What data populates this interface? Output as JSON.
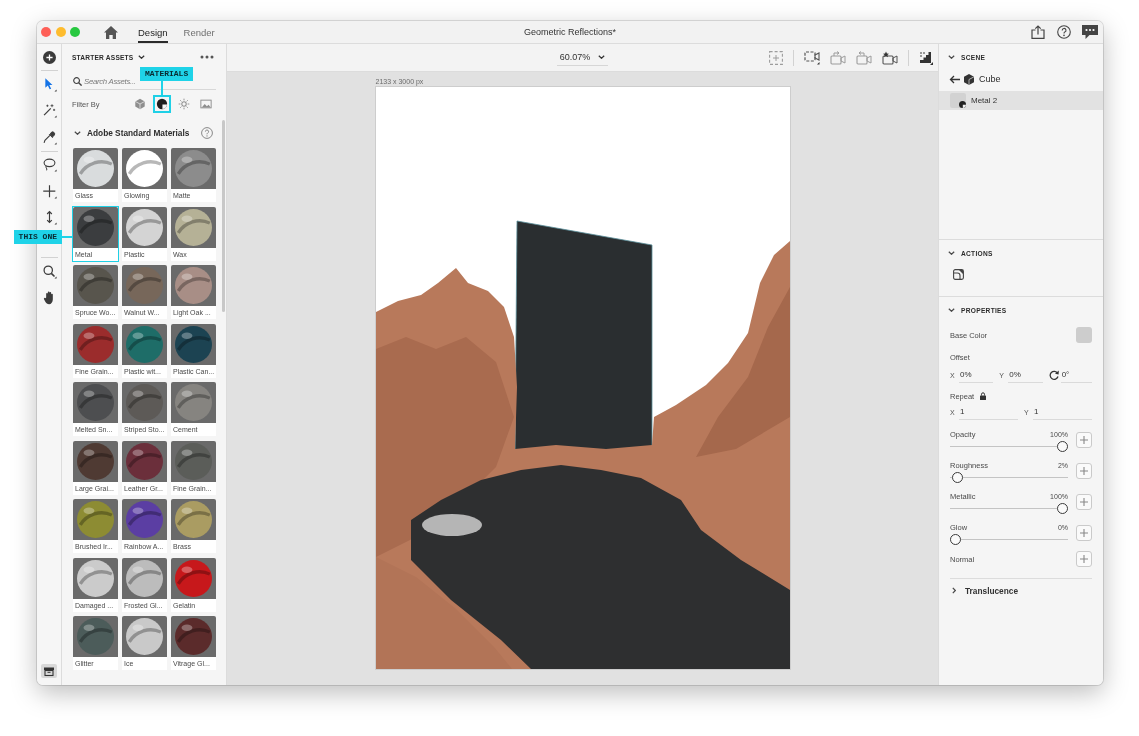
{
  "window": {
    "title": "Geometric Reflections*",
    "tabs": [
      {
        "label": "Design",
        "selected": true
      },
      {
        "label": "Render",
        "selected": false
      }
    ]
  },
  "tool_groups": [
    {
      "tools": [
        {
          "kind": "add",
          "selected": false
        }
      ]
    },
    {
      "tools": [
        {
          "kind": "select",
          "selected": true
        },
        {
          "kind": "wand",
          "selected": false
        },
        {
          "kind": "eyedropper",
          "selected": false
        }
      ]
    },
    {
      "tools": [
        {
          "kind": "lasso",
          "selected": false
        },
        {
          "kind": "move",
          "selected": false
        },
        {
          "kind": "vertical",
          "selected": false
        }
      ]
    },
    {
      "tools": [
        {
          "kind": "zoom",
          "selected": false
        },
        {
          "kind": "hand",
          "selected": false
        }
      ]
    }
  ],
  "assets_panel": {
    "title": "STARTER ASSETS",
    "search": {
      "placeholder": "Search Assets..."
    },
    "filter_label": "Filter By",
    "filters": [
      {
        "kind": "models",
        "selected": false
      },
      {
        "kind": "materials",
        "selected": true,
        "callout": "MATERIALS"
      },
      {
        "kind": "lights",
        "selected": false
      },
      {
        "kind": "images",
        "selected": false
      }
    ],
    "section": {
      "title": "Adobe Standard Materials",
      "expanded": true
    },
    "materials": [
      {
        "label": "Glass",
        "color": "#d9dcdd",
        "selected": false
      },
      {
        "label": "Glowing",
        "color": "#ffffff",
        "selected": false
      },
      {
        "label": "Matte",
        "color": "#8c8c8c",
        "selected": false
      },
      {
        "label": "Metal",
        "color": "#3b3d3f",
        "selected": true,
        "callout": "THIS ONE"
      },
      {
        "label": "Plastic",
        "color": "#d4d4d4",
        "selected": false
      },
      {
        "label": "Wax",
        "color": "#b5b196",
        "selected": false
      },
      {
        "label": "Spruce Wo...",
        "color": "#58554d",
        "selected": false
      },
      {
        "label": "Walnut W...",
        "color": "#77675a",
        "selected": false
      },
      {
        "label": "Light Oak ...",
        "color": "#a88e86",
        "selected": false
      },
      {
        "label": "Fine Grain...",
        "color": "#9b2c2c",
        "selected": false
      },
      {
        "label": "Plastic wit...",
        "color": "#1e6d68",
        "selected": false
      },
      {
        "label": "Plastic Can...",
        "color": "#1c4352",
        "selected": false
      },
      {
        "label": "Melted Sn...",
        "color": "#4d4e50",
        "selected": false
      },
      {
        "label": "Striped Sto...",
        "color": "#5d5a57",
        "selected": false
      },
      {
        "label": "Cement",
        "color": "#868480",
        "selected": false
      },
      {
        "label": "Large Grai...",
        "color": "#4f3a33",
        "selected": false
      },
      {
        "label": "Leather Gr...",
        "color": "#6b2f3b",
        "selected": false
      },
      {
        "label": "Fine Grain...",
        "color": "#5b5d59",
        "selected": false
      },
      {
        "label": "Brushed Ir...",
        "color": "#8d8c33",
        "selected": false
      },
      {
        "label": "Rainbow A...",
        "color": "#5b3ea3",
        "selected": false
      },
      {
        "label": "Brass",
        "color": "#aa9c62",
        "selected": false
      },
      {
        "label": "Damaged ...",
        "color": "#cbcbcb",
        "selected": false
      },
      {
        "label": "Frosted Gl...",
        "color": "#bcbcbc",
        "selected": false
      },
      {
        "label": "Gelatin",
        "color": "#c7181b",
        "selected": false
      },
      {
        "label": "Glitter",
        "color": "#4c5c5a",
        "selected": false
      },
      {
        "label": "Ice",
        "color": "#c9c9c9",
        "selected": false
      },
      {
        "label": "Vitrage Gl...",
        "color": "#5b2b2b",
        "selected": false
      }
    ]
  },
  "canvas": {
    "zoom": "60.07%",
    "artboard_size": "2133 x 3000 px"
  },
  "scene_panel": {
    "title": "SCENE",
    "expanded": true,
    "object": "Cube",
    "layers": [
      {
        "label": "Metal 2",
        "selected": true
      }
    ]
  },
  "actions_panel": {
    "title": "ACTIONS",
    "expanded": true
  },
  "properties_panel": {
    "title": "PROPERTIES",
    "expanded": true,
    "base_color": {
      "label": "Base Color"
    },
    "offset": {
      "label": "Offset",
      "fields": [
        {
          "kind": "axis",
          "label": "X",
          "value": "0%"
        },
        {
          "kind": "axis",
          "label": "Y",
          "value": "0%"
        },
        {
          "kind": "rotation",
          "value": "0°"
        }
      ]
    },
    "repeat": {
      "label": "Repeat",
      "locked": true,
      "fields": [
        {
          "kind": "axis",
          "label": "X",
          "value": "1"
        },
        {
          "kind": "axis",
          "label": "Y",
          "value": "1"
        }
      ]
    },
    "sliders": [
      {
        "label": "Opacity",
        "reading": "100%",
        "level": 1
      },
      {
        "label": "Roughness",
        "reading": "2%",
        "level": 0.02
      },
      {
        "label": "Metallic",
        "reading": "100%",
        "level": 1
      },
      {
        "label": "Glow",
        "reading": "0%",
        "level": 0
      }
    ],
    "normal": {
      "label": "Normal"
    },
    "translucence": {
      "label": "Translucence",
      "expanded": false
    }
  }
}
